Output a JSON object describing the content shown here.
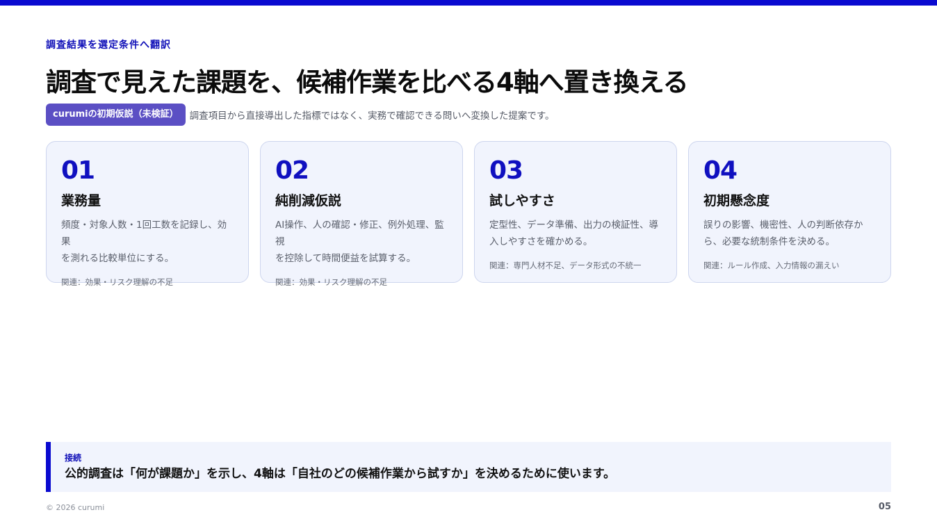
{
  "colors": {
    "accent": "#0a0ad0",
    "badge": "#5b4fc4",
    "card_bg": "#f1f4fd",
    "card_border": "#cdd5ee"
  },
  "header": {
    "eyebrow": "調査結果を選定条件へ翻訳",
    "title": "調査で見えた課題を、候補作業を比べる4軸へ置き換える",
    "badge": "curumiの初期仮説（未検証）",
    "subtitle": "調査項目から直接導出した指標ではなく、実務で確認できる問いへ変換した提案です。"
  },
  "cards": [
    {
      "number": "01",
      "title": "業務量",
      "desc_line1": "頻度・対象人数・1回工数を記録し、効果",
      "desc_line2": "を測れる比較単位にする。",
      "related": "関連：効果・リスク理解の不足"
    },
    {
      "number": "02",
      "title": "純削減仮説",
      "desc_line1": "AI操作、人の確認・修正、例外処理、監視",
      "desc_line2": "を控除して時間便益を試算する。",
      "related": "関連：効果・リスク理解の不足"
    },
    {
      "number": "03",
      "title": "試しやすさ",
      "desc_line1": "定型性、データ準備、出力の検証性、導",
      "desc_line2": "入しやすさを確かめる。",
      "related": "関連：専門人材不足、データ形式の不統一"
    },
    {
      "number": "04",
      "title": "初期懸念度",
      "desc_line1": "誤りの影響、機密性、人の判断依存か",
      "desc_line2": "ら、必要な統制条件を決める。",
      "related": "関連：ルール作成、入力情報の漏えい"
    }
  ],
  "connection": {
    "label": "接続",
    "text": "公的調査は「何が課題か」を示し、4軸は「自社のどの候補作業から試すか」を決めるために使います。"
  },
  "footer": {
    "copyright": "© 2026 curumi",
    "page": "05"
  }
}
